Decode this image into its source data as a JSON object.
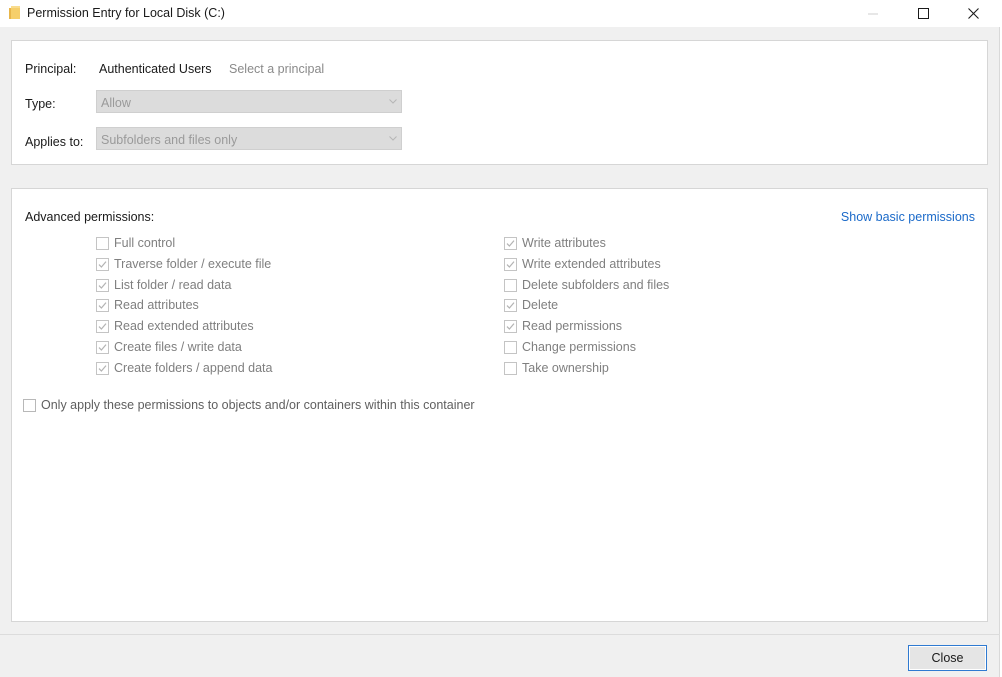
{
  "window": {
    "title": "Permission Entry for Local Disk (C:)"
  },
  "principal": {
    "label": "Principal:",
    "value": "Authenticated Users",
    "link": "Select a principal"
  },
  "type": {
    "label": "Type:",
    "value": "Allow"
  },
  "applies_to": {
    "label": "Applies to:",
    "value": "Subfolders and files only"
  },
  "advanced": {
    "title": "Advanced permissions:",
    "basic_link": "Show basic permissions",
    "left": [
      {
        "label": "Full control",
        "checked": false
      },
      {
        "label": "Traverse folder / execute file",
        "checked": true
      },
      {
        "label": "List folder / read data",
        "checked": true
      },
      {
        "label": "Read attributes",
        "checked": true
      },
      {
        "label": "Read extended attributes",
        "checked": true
      },
      {
        "label": "Create files / write data",
        "checked": true
      },
      {
        "label": "Create folders / append data",
        "checked": true
      }
    ],
    "right": [
      {
        "label": "Write attributes",
        "checked": true
      },
      {
        "label": "Write extended attributes",
        "checked": true
      },
      {
        "label": "Delete subfolders and files",
        "checked": false
      },
      {
        "label": "Delete",
        "checked": true
      },
      {
        "label": "Read permissions",
        "checked": true
      },
      {
        "label": "Change permissions",
        "checked": false
      },
      {
        "label": "Take ownership",
        "checked": false
      }
    ],
    "only_apply": {
      "label": "Only apply these permissions to objects and/or containers within this container",
      "checked": false
    }
  },
  "footer": {
    "close_label": "Close"
  },
  "colors": {
    "link": "#1b6ac9",
    "disabled_text": "#7f7f7f",
    "focus_border": "#2f7ad1"
  }
}
